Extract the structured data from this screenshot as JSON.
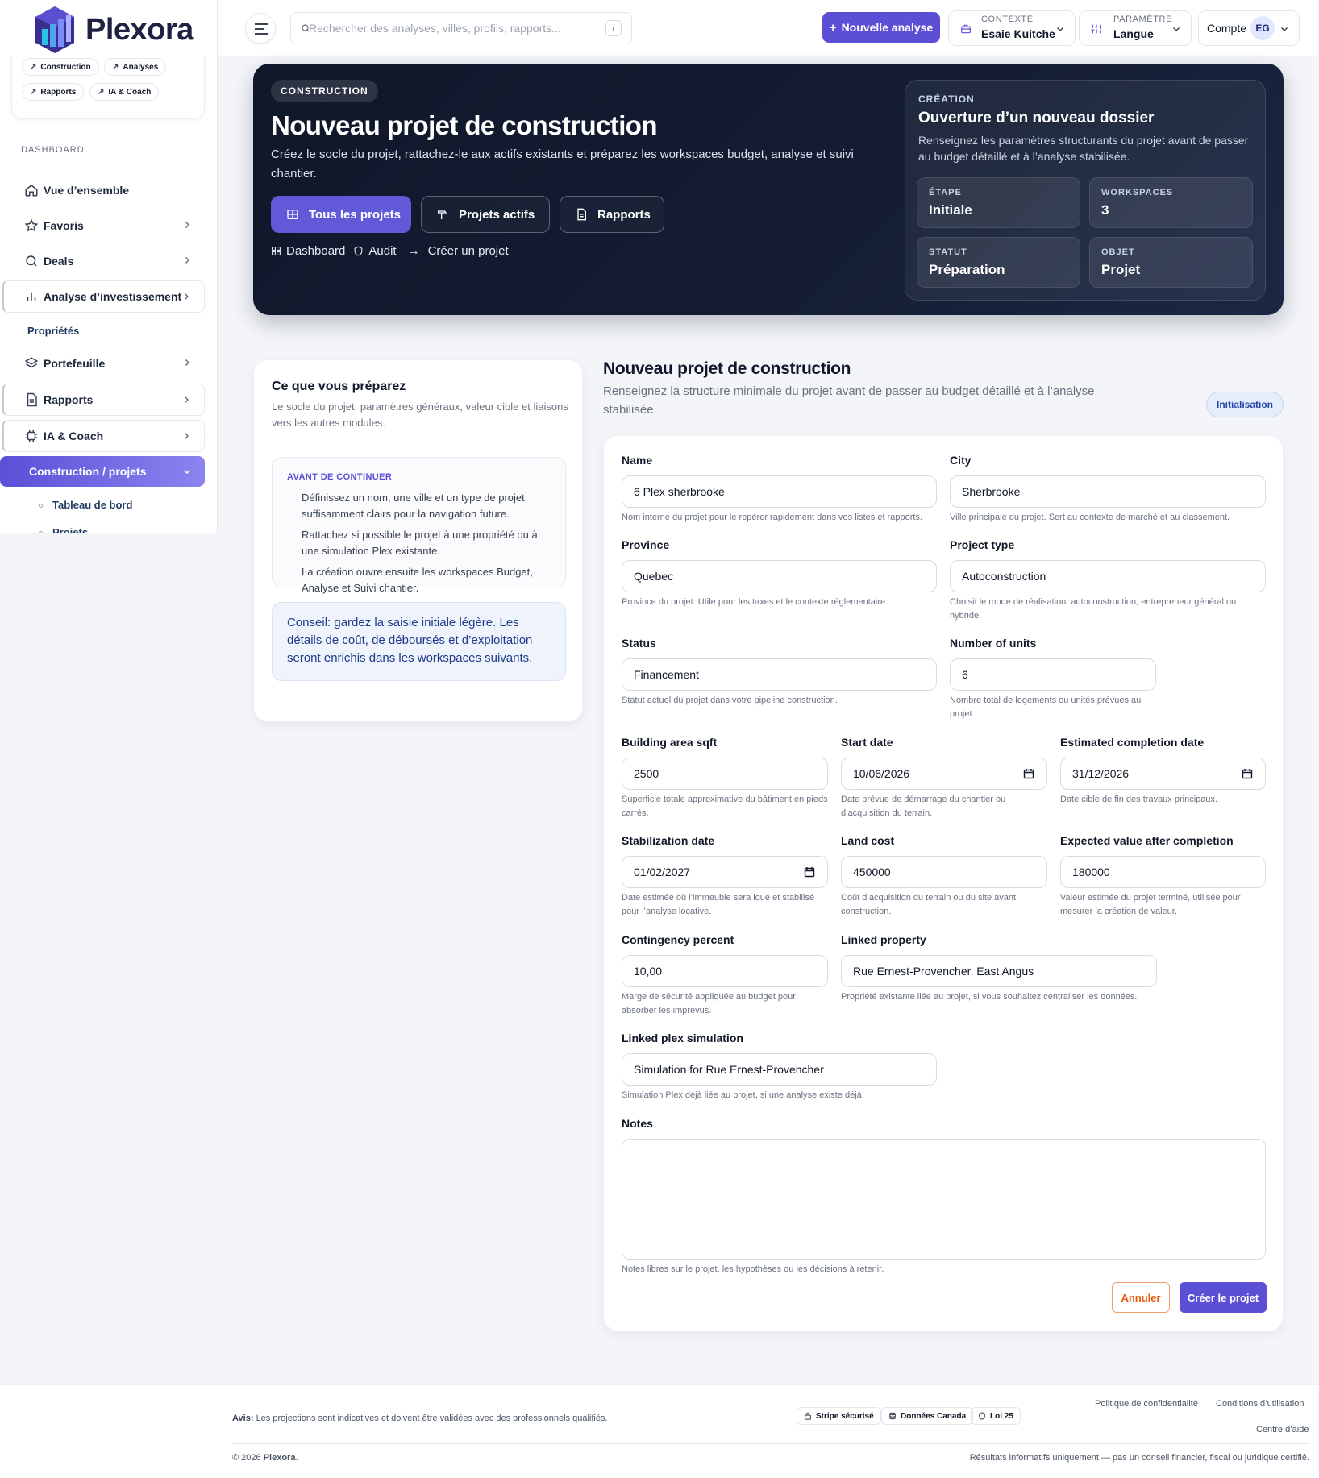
{
  "brand": {
    "name": "Plexora"
  },
  "sidebar": {
    "quick_links": [
      "Construction",
      "Analyses",
      "Rapports",
      "IA & Coach"
    ],
    "section_label": "DASHBOARD",
    "items": [
      {
        "label": "Vue d’ensemble"
      },
      {
        "label": "Favoris"
      },
      {
        "label": "Deals"
      },
      {
        "label": "Analyse d’investissement"
      },
      {
        "label": "Propriétés"
      },
      {
        "label": "Portefeuille"
      },
      {
        "label": "Rapports"
      },
      {
        "label": "IA & Coach"
      },
      {
        "label": "Construction / projets"
      }
    ],
    "sub_items": [
      {
        "label": "Tableau de bord"
      },
      {
        "label": "Projets"
      }
    ]
  },
  "topbar": {
    "search_placeholder": "Rechercher des analyses, villes, profils, rapports...",
    "search_shortcut": "/",
    "new_button": "Nouvelle analyse",
    "context": {
      "caption": "CONTEXTE",
      "value": "Esaie Kuitche"
    },
    "parameter": {
      "caption": "PARAMÈTRE",
      "value": "Langue"
    },
    "account": {
      "label": "Compte",
      "initials": "EG"
    }
  },
  "hero": {
    "tag": "CONSTRUCTION",
    "title": "Nouveau projet de construction",
    "subtitle": "Créez le socle du projet, rattachez-le aux actifs existants et préparez les workspaces budget, analyse et suivi chantier.",
    "buttons": [
      "Tous les projets",
      "Projets actifs",
      "Rapports"
    ],
    "breadcrumb": [
      "Dashboard",
      "Audit",
      "Créer un projet"
    ],
    "card": {
      "caption": "CRÉATION",
      "title": "Ouverture d’un nouveau dossier",
      "subtitle": "Renseignez les paramètres structurants du projet avant de passer au budget détaillé et à l’analyse stabilisée.",
      "stats": [
        {
          "caption": "ÉTAPE",
          "value": "Initiale"
        },
        {
          "caption": "WORKSPACES",
          "value": "3"
        },
        {
          "caption": "STATUT",
          "value": "Préparation"
        },
        {
          "caption": "OBJET",
          "value": "Projet"
        }
      ]
    }
  },
  "prep": {
    "title": "Ce que vous préparez",
    "subtitle": "Le socle du projet: paramètres généraux, valeur cible et liaisons vers les autres modules.",
    "before_caption": "AVANT DE CONTINUER",
    "before_items": [
      "Définissez un nom, une ville et un type de projet suffisamment clairs pour la navigation future.",
      "Rattachez si possible le projet à une propriété ou à une simulation Plex existante.",
      "La création ouvre ensuite les workspaces Budget, Analyse et Suivi chantier."
    ],
    "tip": "Conseil: gardez la saisie initiale légère. Les détails de coût, de déboursés et d’exploitation seront enrichis dans les workspaces suivants."
  },
  "form": {
    "title": "Nouveau projet de construction",
    "subtitle": "Renseignez la structure minimale du projet avant de passer au budget détaillé et à l’analyse stabilisée.",
    "badge": "Initialisation",
    "fields": {
      "name": {
        "label": "Name",
        "value": "6 Plex sherbrooke",
        "hint": "Nom interne du projet pour le repérer rapidement dans vos listes et rapports."
      },
      "city": {
        "label": "City",
        "value": "Sherbrooke",
        "hint": "Ville principale du projet. Sert au contexte de marché et au classement."
      },
      "province": {
        "label": "Province",
        "value": "Quebec",
        "hint": "Province du projet. Utile pour les taxes et le contexte réglementaire."
      },
      "project_type": {
        "label": "Project type",
        "value": "Autoconstruction",
        "hint": "Choisit le mode de réalisation: autoconstruction, entrepreneur général ou hybride."
      },
      "status": {
        "label": "Status",
        "value": "Financement",
        "hint": "Statut actuel du projet dans votre pipeline construction."
      },
      "units": {
        "label": "Number of units",
        "value": "6",
        "hint": "Nombre total de logements ou unités prévues au projet."
      },
      "area": {
        "label": "Building area sqft",
        "value": "2500",
        "hint": "Superficie totale approximative du bâtiment en pieds carrés."
      },
      "start_date": {
        "label": "Start date",
        "value": "10/06/2026",
        "hint": "Date prévue de démarrage du chantier ou d’acquisition du terrain."
      },
      "completion_date": {
        "label": "Estimated completion date",
        "value": "31/12/2026",
        "hint": "Date cible de fin des travaux principaux."
      },
      "stabilization_date": {
        "label": "Stabilization date",
        "value": "01/02/2027",
        "hint": "Date estimée où l’immeuble sera loué et stabilisé pour l’analyse locative."
      },
      "land_cost": {
        "label": "Land cost",
        "value": "450000",
        "hint": "Coût d’acquisition du terrain ou du site avant construction."
      },
      "expected_value": {
        "label": "Expected value after completion",
        "value": "180000",
        "hint": "Valeur estimée du projet terminé, utilisée pour mesurer la création de valeur."
      },
      "contingency": {
        "label": "Contingency percent",
        "value": "10,00",
        "hint": "Marge de sécurité appliquée au budget pour absorber les imprévus."
      },
      "linked_property": {
        "label": "Linked property",
        "value": "Rue Ernest-Provencher, East Angus",
        "hint": "Propriété existante liée au projet, si vous souhaitez centraliser les données."
      },
      "linked_simulation": {
        "label": "Linked plex simulation",
        "value": "Simulation for Rue Ernest-Provencher",
        "hint": "Simulation Plex déjà liée au projet, si une analyse existe déjà."
      },
      "notes": {
        "label": "Notes",
        "value": "",
        "hint": "Notes libres sur le projet, les hypothèses ou les décisions à retenir."
      }
    },
    "cancel": "Annuler",
    "submit": "Créer le projet"
  },
  "footer": {
    "notice_label": "Avis:",
    "notice": "Les projections sont indicatives et doivent être validées avec des professionnels qualifiés.",
    "chips": [
      "Stripe sécurisé",
      "Données Canada",
      "Loi 25"
    ],
    "links": [
      "Politique de confidentialité",
      "Conditions d’utilisation",
      "Centre d’aide"
    ],
    "copyright_prefix": "© 2026",
    "copyright_brand": "Plexora",
    "copyright_suffix": ".",
    "disclaimer": "Résultats informatifs uniquement — pas un conseil financier, fiscal ou juridique certifié."
  }
}
